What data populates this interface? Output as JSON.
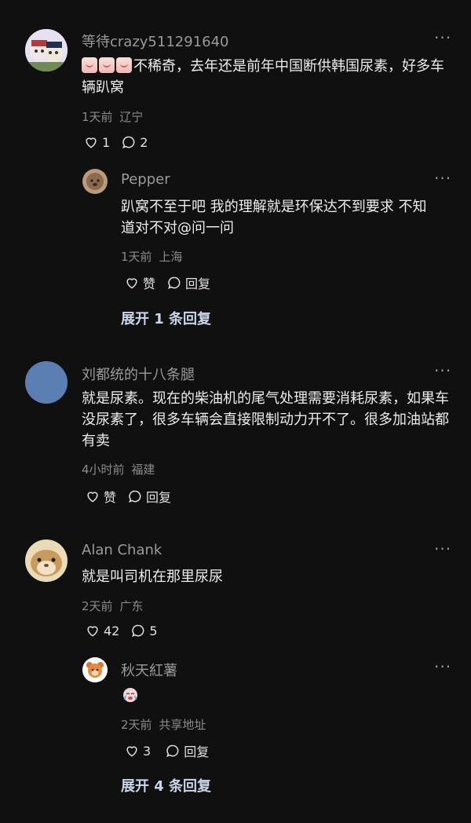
{
  "comments": [
    {
      "username": "等待crazy511291640",
      "text": "不稀奇，去年还是前年中国断供韩国尿素，好多车辆趴窝",
      "time": "1天前",
      "location": "辽宁",
      "likes": "1",
      "replies": "2",
      "emojis": [
        "laugh-cry-emoji",
        "laugh-cry-emoji",
        "laugh-cry-emoji"
      ]
    },
    {
      "username": "刘都统的十八条腿",
      "text": "就是尿素。现在的柴油机的尾气处理需要消耗尿素，如果车没尿素了，很多车辆会直接限制动力开不了。很多加油站都有卖",
      "time": "4小时前",
      "location": "福建",
      "likes": "赞",
      "replies": "回复"
    },
    {
      "username": "Alan Chank",
      "text": "就是叫司机在那里尿尿",
      "time": "2天前",
      "location": "广东",
      "likes": "42",
      "replies": "5"
    }
  ],
  "replies": [
    {
      "username": "Pepper",
      "text_lines": [
        "趴窝不至于吧 我的理解就是环保达不到要求 不知",
        "道对不对"
      ],
      "mention": "@问一问",
      "time": "1天前",
      "location": "上海",
      "likes": "赞",
      "replies": "回复"
    },
    {
      "username": "秋天紅薯",
      "emoji": "crying-emoji",
      "time": "2天前",
      "location": "共享地址",
      "likes": "3",
      "replies": "回复"
    }
  ],
  "expand": {
    "first": "展开 1 条回复",
    "second": "展开 4 条回复"
  },
  "more_label": "···",
  "colors": {
    "background": "#101010",
    "text": "#ececec",
    "muted": "#8a8a8a",
    "expand": "#c9d6ea",
    "avatar_blue": "#5c7fb3"
  }
}
